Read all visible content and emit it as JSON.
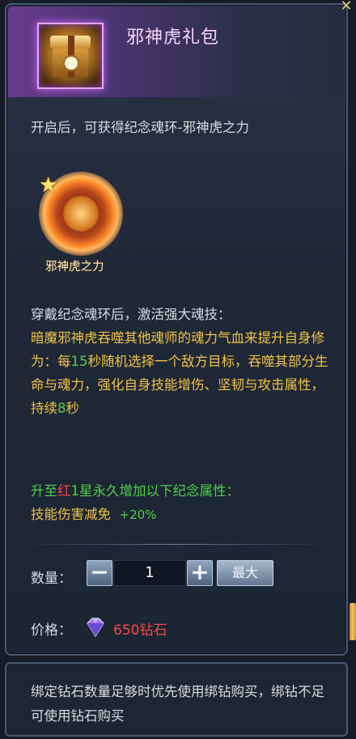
{
  "header": {
    "title": "邪神虎礼包",
    "close_icon": "close-x-icon"
  },
  "item": {
    "icon": "gift-box-icon"
  },
  "description": {
    "intro": "开启后，可获得纪念魂环-邪神虎之力"
  },
  "soul_ring": {
    "name": "邪神虎之力",
    "icon": "flaming-tiger-ring-icon"
  },
  "skill": {
    "heading": "穿戴纪念魂环后，激活强大魂技：",
    "text_a": "暗魔邪神虎吞噬其他魂师的魂力气血来提升自身修为：每",
    "interval": "15",
    "text_b": "秒随机选择一个敌方目标，吞噬其部分生命与魂力，强化自身技能增伤、坚韧与攻击属性，持续",
    "duration": "8",
    "text_c": "秒"
  },
  "upgrade": {
    "prefix": "升至",
    "level_color": "红",
    "level_star": "1星",
    "suffix": "永久增加以下纪念属性：",
    "attr_name": "技能伤害减免",
    "attr_value": "+20%"
  },
  "quantity": {
    "label": "数量：",
    "value": "1",
    "minus": "−",
    "plus": "+",
    "max_label": "最大"
  },
  "price": {
    "label": "价格：",
    "value": "650钻石",
    "icon": "diamond-icon"
  },
  "notice": {
    "text": "绑定钻石数量足够时优先使用绑钻购买，绑钻不足可使用钻石购买"
  },
  "colors": {
    "accent_gold": "#f0c245",
    "highlight_green": "#4ed14a",
    "price_red": "#f24a4a"
  }
}
